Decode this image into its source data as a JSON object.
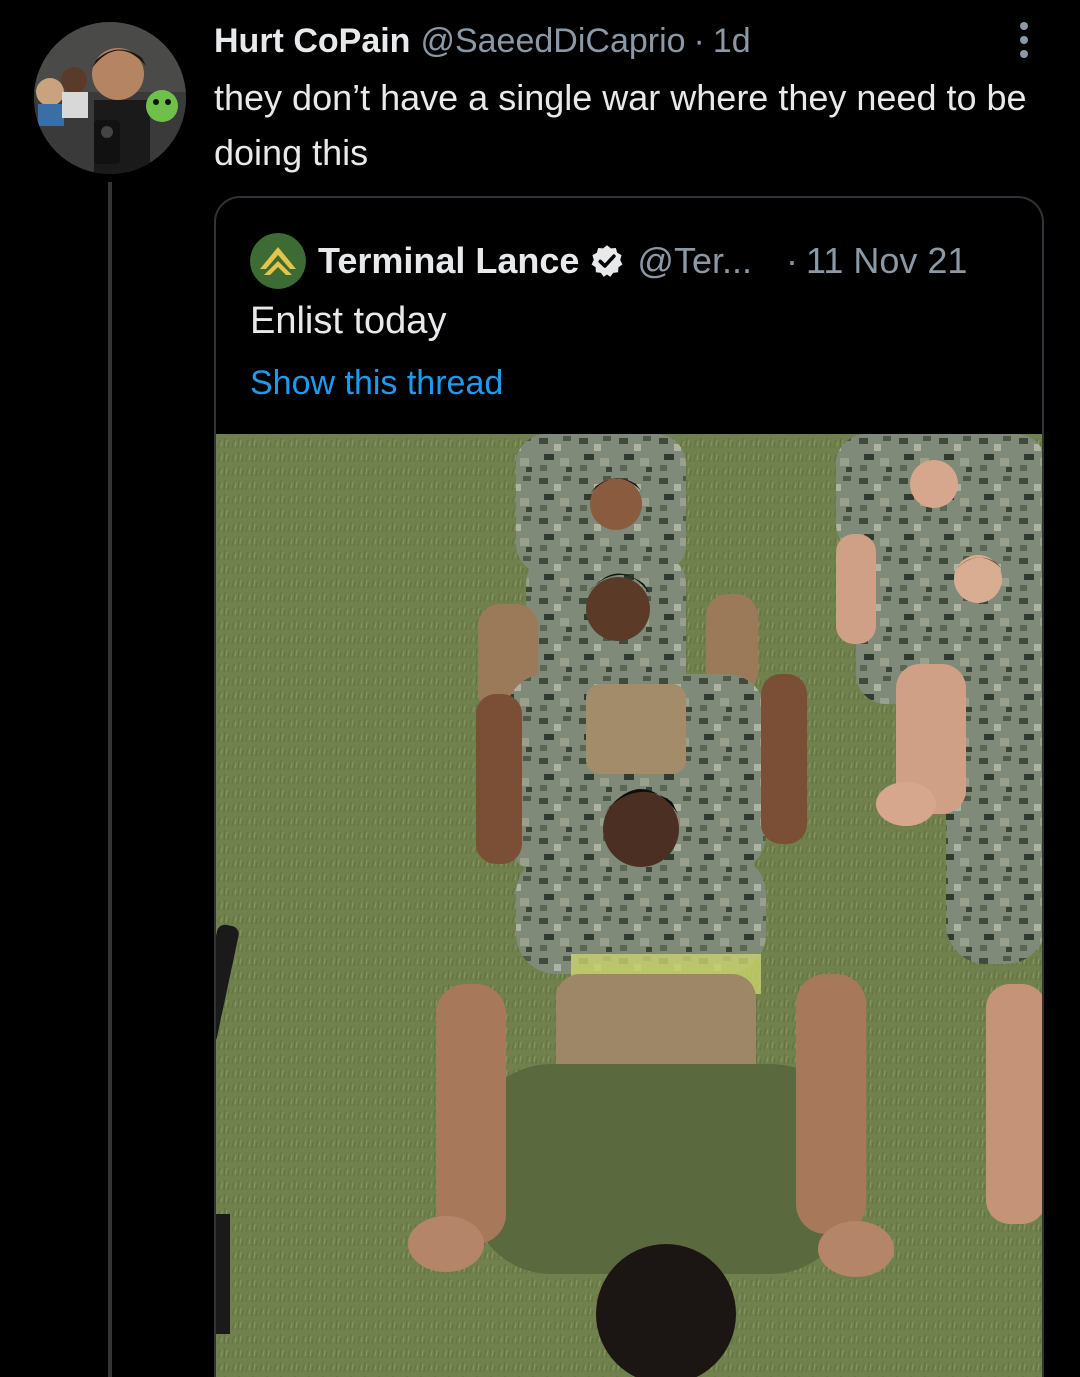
{
  "tweet": {
    "author_name": "Hurt CoPain",
    "author_handle": "@SaeedDiCaprio",
    "separator": "·",
    "time": "1d",
    "text": "they don’t have a single war where they need to be doing this",
    "more_icon": "more-dots-icon"
  },
  "quoted": {
    "author_name": "Terminal Lance",
    "author_handle": "@Ter...",
    "separator": "·",
    "time": "11 Nov 21",
    "text": "Enlist today",
    "show_thread": "Show this thread",
    "verified_icon": "verified-badge-icon",
    "media_description": "photo of marines doing push-ups on grass",
    "media_colors": {
      "grass": "#6b7d4a",
      "camo": "#7f8a78",
      "skin": "#8a5b3f"
    }
  },
  "colors": {
    "background": "#000000",
    "text_primary": "#e7e9ea",
    "text_secondary": "#8b98a5",
    "link": "#1d9bf0",
    "border": "#2f3336"
  }
}
